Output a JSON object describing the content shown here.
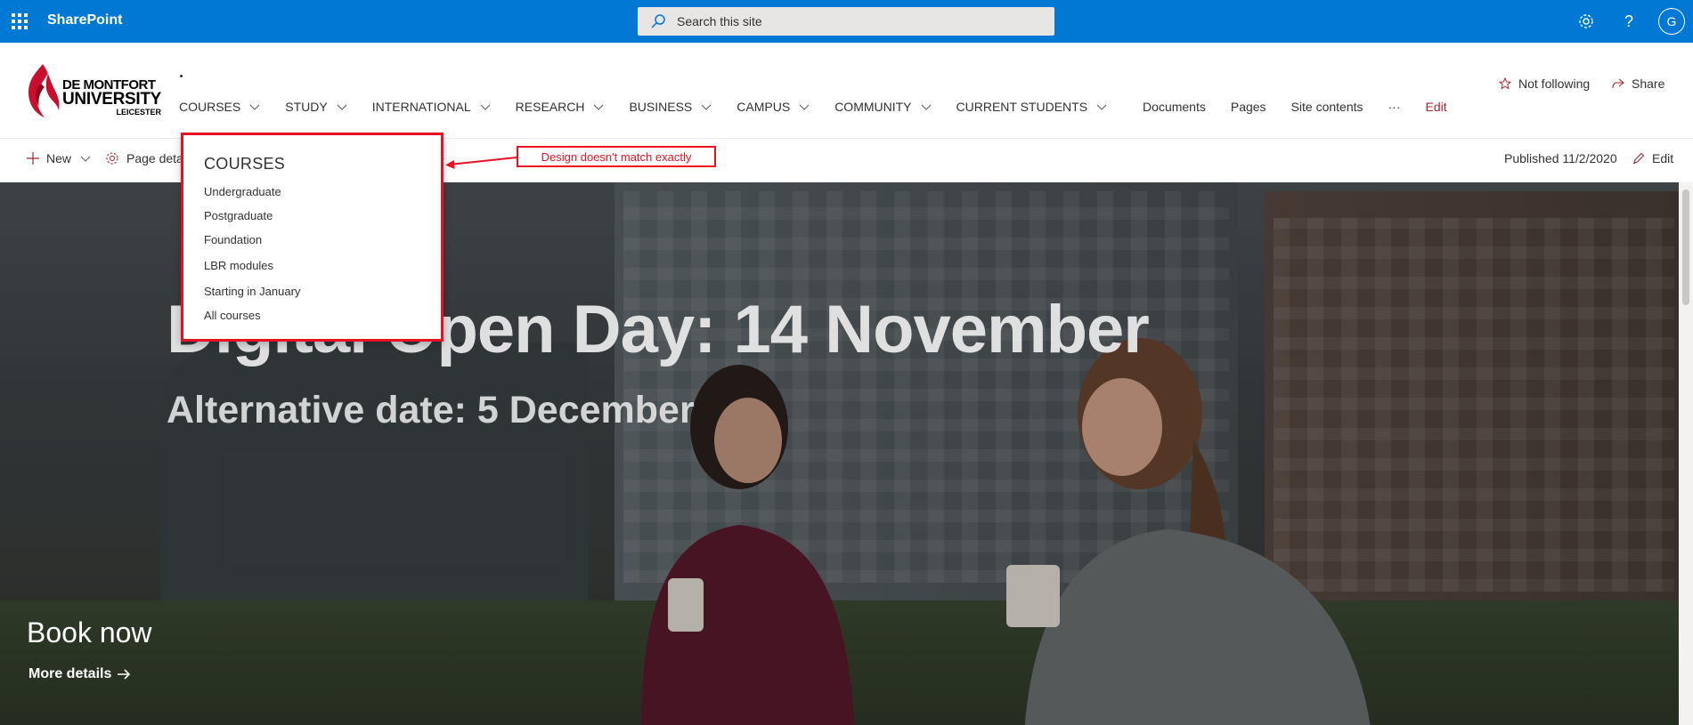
{
  "suitebar": {
    "brand": "SharePoint",
    "search_placeholder": "Search this site",
    "avatar_initial": "G",
    "help_label": "?"
  },
  "logo": {
    "line1": "DE MONTFORT",
    "line2": "UNIVERSITY",
    "line3": "LEICESTER"
  },
  "site_title": "·",
  "nav": {
    "items": [
      {
        "label": "COURSES",
        "dropdown": true
      },
      {
        "label": "STUDY",
        "dropdown": true
      },
      {
        "label": "INTERNATIONAL",
        "dropdown": true
      },
      {
        "label": "RESEARCH",
        "dropdown": true
      },
      {
        "label": "BUSINESS",
        "dropdown": true
      },
      {
        "label": "CAMPUS",
        "dropdown": true
      },
      {
        "label": "COMMUNITY",
        "dropdown": true
      },
      {
        "label": "CURRENT STUDENTS",
        "dropdown": true
      },
      {
        "label": "Documents",
        "dropdown": false
      },
      {
        "label": "Pages",
        "dropdown": false
      },
      {
        "label": "Site contents",
        "dropdown": false
      },
      {
        "label": "···",
        "dropdown": false
      }
    ],
    "edit_label": "Edit"
  },
  "header_actions": {
    "follow_label": "Not following",
    "share_label": "Share"
  },
  "commandbar": {
    "new_label": "New",
    "page_details_label": "Page deta",
    "published": "Published 11/2/2020",
    "edit_label": "Edit"
  },
  "dropdown": {
    "title": "COURSES",
    "items": [
      "Undergraduate",
      "Postgraduate",
      "Foundation",
      "LBR modules",
      "Starting in January",
      "All courses"
    ]
  },
  "annotation": "Design doesn't match exactly",
  "hero": {
    "title": "Digital Open Day: 14 November",
    "subtitle": "Alternative date: 5 December",
    "cta_heading": "Book now",
    "cta_link": "More details"
  },
  "colors": {
    "suitebar": "#0078d4",
    "accent_edit": "#a4262c",
    "annotation": "#e81123"
  }
}
